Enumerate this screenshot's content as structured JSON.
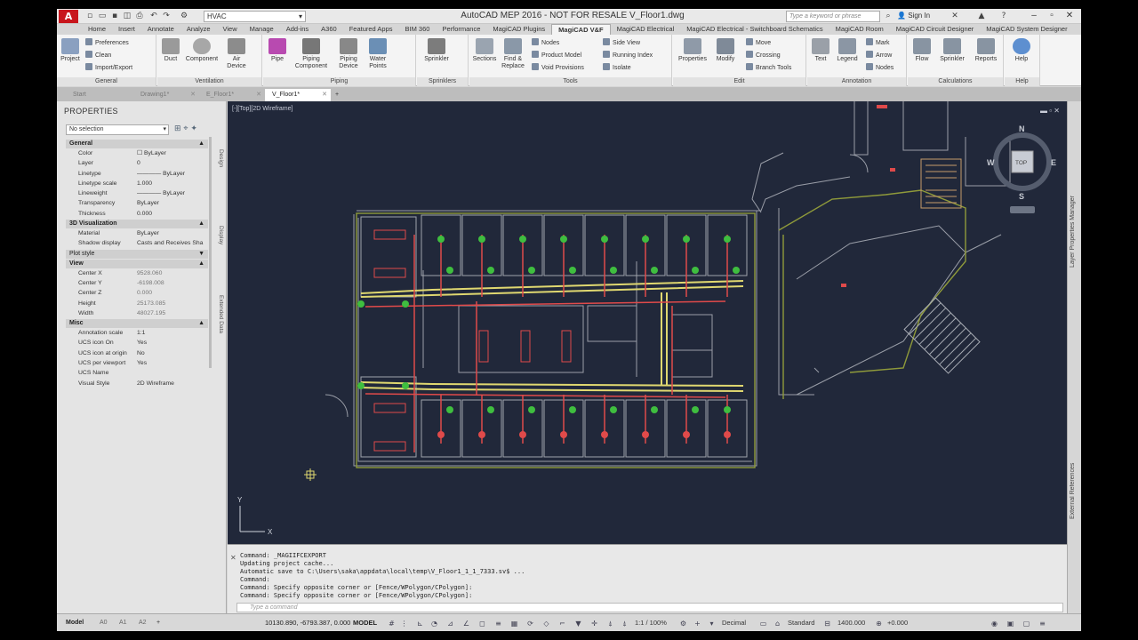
{
  "app": {
    "logo": "A",
    "window_title": "AutoCAD MEP 2016 - NOT FOR RESALE    V_Floor1.dwg",
    "workspace": "HVAC",
    "search_placeholder": "Type a keyword or phrase",
    "sign_in": "Sign In"
  },
  "menu_tabs": [
    "Home",
    "Insert",
    "Annotate",
    "Analyze",
    "View",
    "Manage",
    "Add-ins",
    "A360",
    "Featured Apps",
    "BIM 360",
    "Performance",
    "MagiCAD Plugins",
    "MagiCAD V&F",
    "MagiCAD Electrical",
    "MagiCAD Electrical - Switchboard Schematics",
    "MagiCAD Room",
    "MagiCAD Circuit Designer",
    "MagiCAD System Designer"
  ],
  "ribbon": {
    "general": {
      "label": "General",
      "project": "Project",
      "preferences": "Preferences",
      "clean": "Clean",
      "import_export": "Import/Export"
    },
    "ventilation": {
      "label": "Ventilation",
      "duct": "Duct",
      "component": "Component",
      "air_device": "Air Device"
    },
    "piping": {
      "label": "Piping",
      "pipe": "Pipe",
      "piping_component": "Piping Component",
      "piping_device": "Piping Device",
      "water_points": "Water Points"
    },
    "sprinklers": {
      "label": "Sprinklers",
      "sprinkler": "Sprinkler"
    },
    "tools": {
      "label": "Tools",
      "sections": "Sections",
      "find_replace": "Find & Replace",
      "nodes": "Nodes",
      "product_model": "Product Model",
      "void_provisions": "Void Provisions",
      "side_view": "Side View",
      "running_index": "Running Index",
      "isolate": "Isolate"
    },
    "edit": {
      "label": "Edit",
      "properties": "Properties",
      "modify": "Modify",
      "move": "Move",
      "crossing": "Crossing",
      "branch_tools": "Branch Tools"
    },
    "annotation": {
      "label": "Annotation",
      "text": "Text",
      "legend": "Legend",
      "mark": "Mark",
      "arrow": "Arrow",
      "nodes": "Nodes"
    },
    "calculations": {
      "label": "Calculations",
      "flow": "Flow",
      "sprinkler": "Sprinkler",
      "reports": "Reports"
    },
    "help": {
      "label": "Help",
      "help": "Help"
    }
  },
  "doc_tabs": [
    {
      "label": "Start"
    },
    {
      "label": "Drawing1*"
    },
    {
      "label": "E_Floor1*"
    },
    {
      "label": "V_Floor1*"
    }
  ],
  "properties": {
    "title": "PROPERTIES",
    "selection": "No selection",
    "side_tabs": [
      "Design",
      "Display",
      "Extended Data"
    ],
    "sections": {
      "general": {
        "title": "General",
        "rows": [
          {
            "k": "Color",
            "v": "☐ ByLayer"
          },
          {
            "k": "Layer",
            "v": "0"
          },
          {
            "k": "Linetype",
            "v": "———— ByLayer"
          },
          {
            "k": "Linetype scale",
            "v": "1.000"
          },
          {
            "k": "Lineweight",
            "v": "———— ByLayer"
          },
          {
            "k": "Transparency",
            "v": "ByLayer"
          },
          {
            "k": "Thickness",
            "v": "0.000"
          }
        ]
      },
      "viz": {
        "title": "3D Visualization",
        "rows": [
          {
            "k": "Material",
            "v": "ByLayer"
          },
          {
            "k": "Shadow display",
            "v": "Casts and Receives Sha"
          }
        ]
      },
      "plot": {
        "title": "Plot style"
      },
      "view": {
        "title": "View",
        "rows": [
          {
            "k": "Center X",
            "v": "9528.060"
          },
          {
            "k": "Center Y",
            "v": "-6198.008"
          },
          {
            "k": "Center Z",
            "v": "0.000"
          },
          {
            "k": "Height",
            "v": "25173.085"
          },
          {
            "k": "Width",
            "v": "48027.195"
          }
        ]
      },
      "misc": {
        "title": "Misc",
        "rows": [
          {
            "k": "Annotation scale",
            "v": "1:1"
          },
          {
            "k": "UCS icon On",
            "v": "Yes"
          },
          {
            "k": "UCS icon at origin",
            "v": "No"
          },
          {
            "k": "UCS per viewport",
            "v": "Yes"
          },
          {
            "k": "UCS Name",
            "v": ""
          },
          {
            "k": "Visual Style",
            "v": "2D Wireframe"
          }
        ]
      }
    }
  },
  "viewport": {
    "label": "[-][Top][2D Wireframe]",
    "compass": {
      "n": "N",
      "s": "S",
      "e": "E",
      "w": "W",
      "top": "TOP"
    },
    "ucs": {
      "y": "Y",
      "x": "X"
    }
  },
  "right_palettes": [
    "Layer Properties Manager",
    "External References"
  ],
  "command": {
    "history": [
      "Command: _MAGIIFCEXPORT",
      "Updating project cache...",
      "Automatic save to C:\\Users\\saka\\appdata\\local\\temp\\V_Floor1_1_1_7333.sv$ ...",
      "Command:",
      "Command: Specify opposite corner or [Fence/WPolygon/CPolygon]:",
      "Command: Specify opposite corner or [Fence/WPolygon/CPolygon]:"
    ],
    "placeholder": "Type a command"
  },
  "layout_tabs": [
    "Model",
    "A0",
    "A1",
    "A2"
  ],
  "status": {
    "coords": "10130.890, -6793.387, 0.000",
    "space": "MODEL",
    "scale": "1:1 / 100%",
    "units": "Decimal",
    "style": "Standard",
    "elevation": "1400.000",
    "offset": "+0.000"
  }
}
